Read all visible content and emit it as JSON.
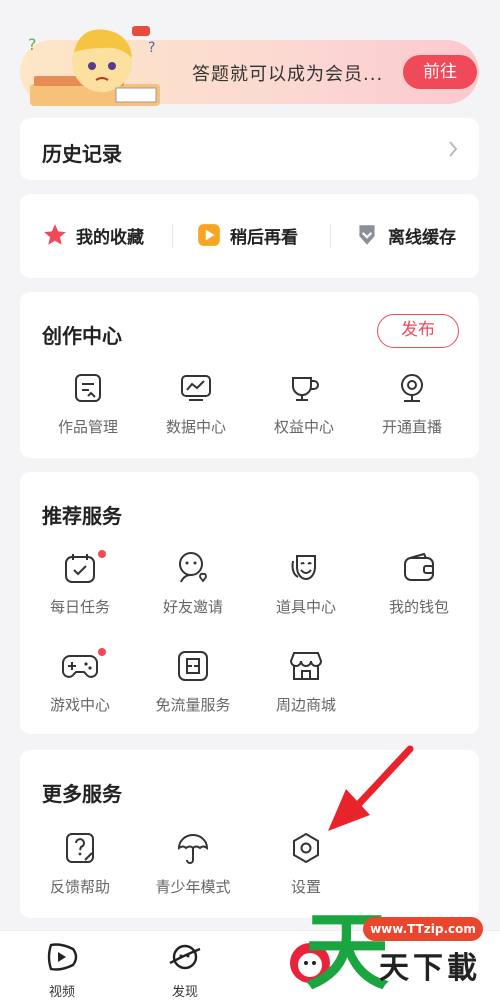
{
  "banner": {
    "text": "答题就可以成为会员...",
    "button": "前往"
  },
  "history": {
    "title": "历史记录"
  },
  "quick": [
    {
      "label": "我的收藏",
      "icon": "star-icon"
    },
    {
      "label": "稍后再看",
      "icon": "play-later-icon"
    },
    {
      "label": "离线缓存",
      "icon": "download-icon"
    }
  ],
  "create": {
    "title": "创作中心",
    "publish": "发布",
    "items": [
      {
        "label": "作品管理",
        "icon": "works-icon"
      },
      {
        "label": "数据中心",
        "icon": "data-chart-icon"
      },
      {
        "label": "权益中心",
        "icon": "cup-icon"
      },
      {
        "label": "开通直播",
        "icon": "webcam-icon"
      }
    ]
  },
  "recommend": {
    "title": "推荐服务",
    "items": [
      {
        "label": "每日任务",
        "icon": "calendar-check-icon",
        "dot": true
      },
      {
        "label": "好友邀请",
        "icon": "invite-friend-icon",
        "dot": false
      },
      {
        "label": "道具中心",
        "icon": "mask-icon",
        "dot": false
      },
      {
        "label": "我的钱包",
        "icon": "wallet-icon",
        "dot": false
      },
      {
        "label": "游戏中心",
        "icon": "gamepad-icon",
        "dot": true
      },
      {
        "label": "免流量服务",
        "icon": "sim-card-icon",
        "dot": false
      },
      {
        "label": "周边商城",
        "icon": "shop-icon",
        "dot": false
      }
    ]
  },
  "more": {
    "title": "更多服务",
    "items": [
      {
        "label": "反馈帮助",
        "icon": "help-icon"
      },
      {
        "label": "青少年模式",
        "icon": "umbrella-icon"
      },
      {
        "label": "设置",
        "icon": "settings-hexagon-icon"
      }
    ]
  },
  "tabs": [
    {
      "label": "视频",
      "icon": "video-tab-icon"
    },
    {
      "label": "发现",
      "icon": "planet-tab-icon"
    }
  ],
  "watermark": {
    "url": "www.TTzip.com",
    "big": "天",
    "small": "天下載"
  },
  "colors": {
    "accent": "#f04a5a",
    "watermark_green": "#1aa541",
    "play_later": "#f6a623"
  }
}
